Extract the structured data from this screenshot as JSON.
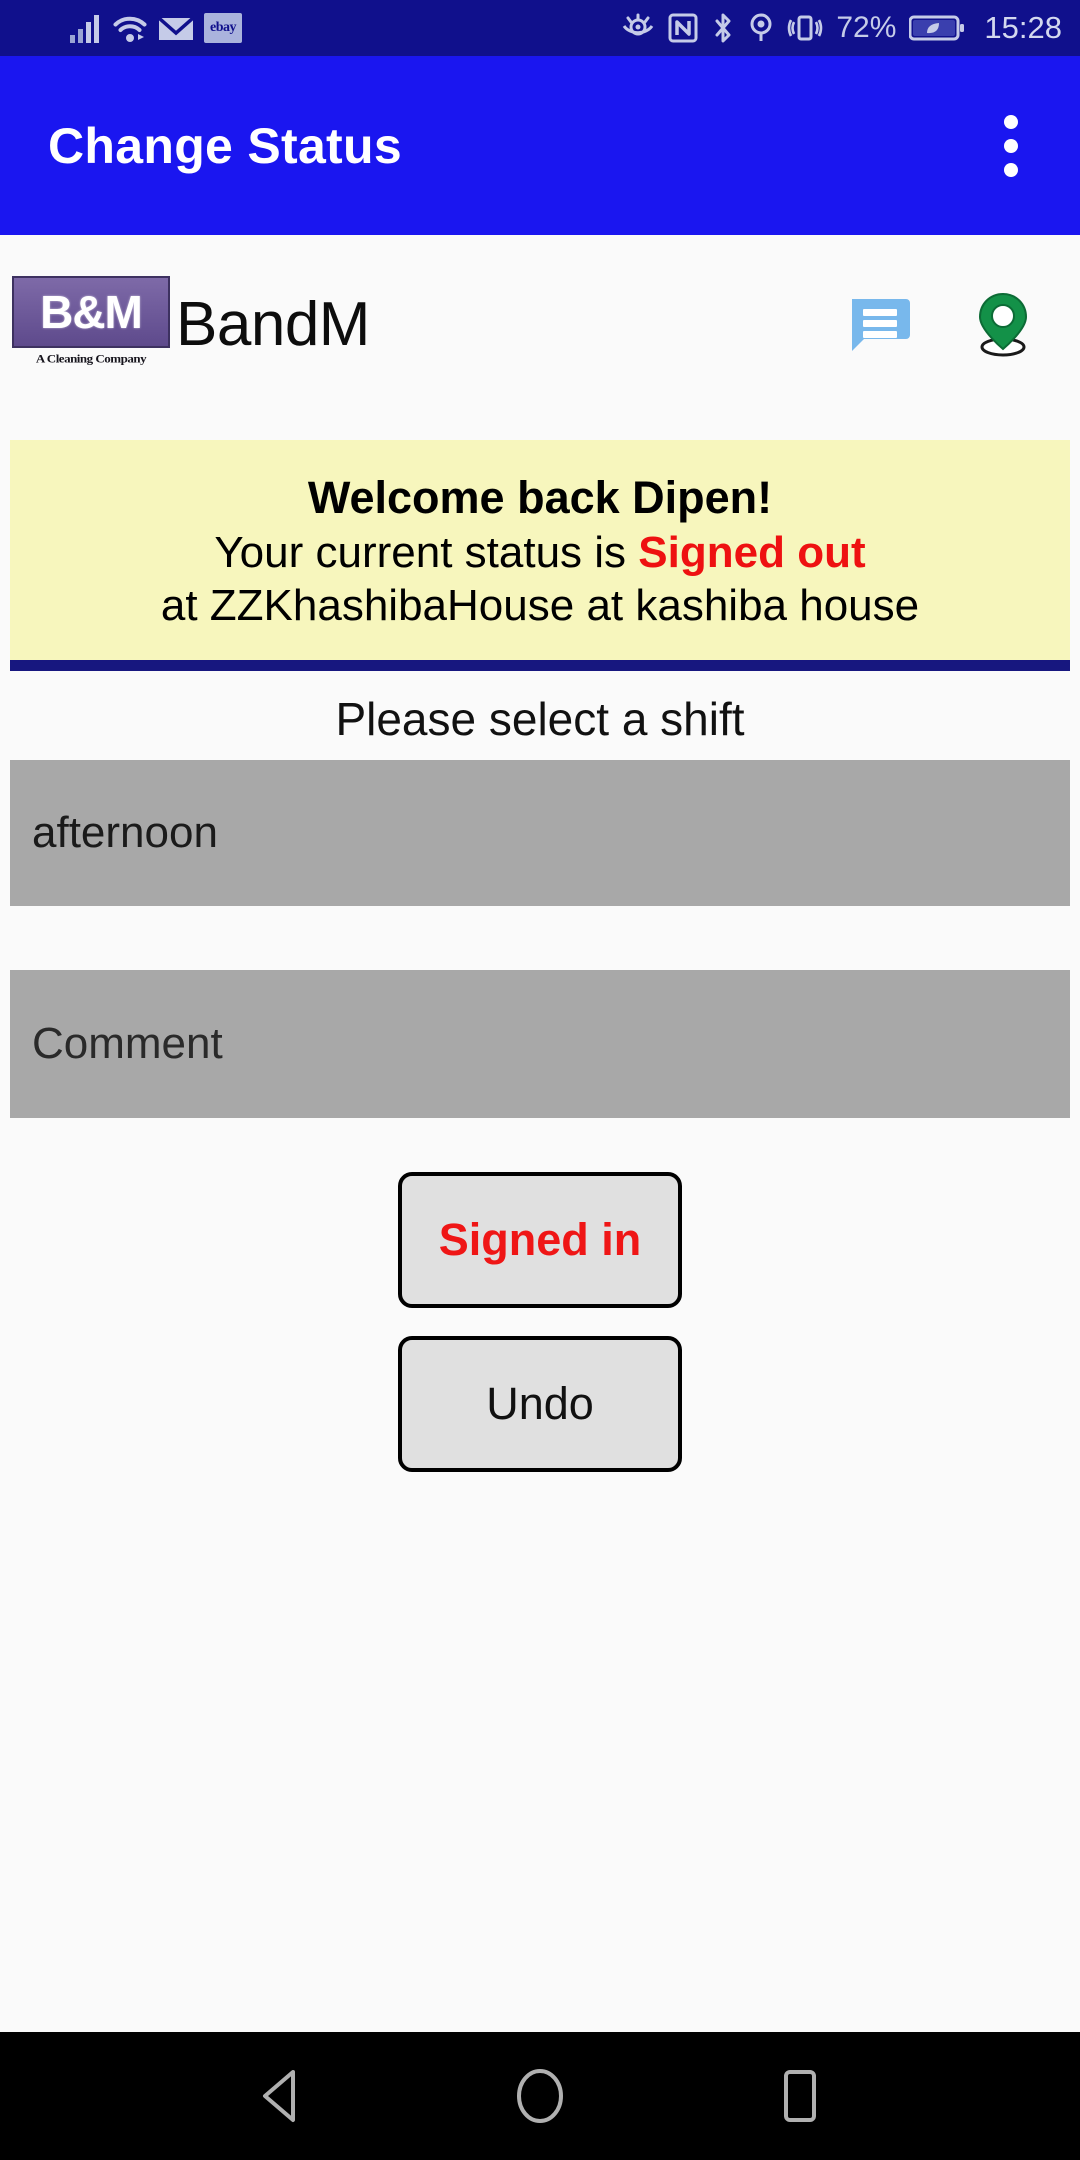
{
  "statusbar": {
    "icons_left": [
      "signal-icon",
      "wifi-icon",
      "email-icon",
      "ebay-icon"
    ],
    "ebay_label": "ebay",
    "icons_right": [
      "eye-comfort-icon",
      "nfc-icon",
      "bluetooth-icon",
      "location-icon",
      "vibrate-icon"
    ],
    "battery_percent": "72%",
    "battery_icon": "battery-saver-icon",
    "time": "15:28"
  },
  "appbar": {
    "title": "Change Status",
    "overflow_icon": "overflow-menu-icon",
    "background": "#1a16f0"
  },
  "brand": {
    "logo_text": "B&M",
    "logo_subtext": "A Cleaning Company",
    "name": "BandM",
    "message_icon": "message-icon",
    "location_icon": "location-pin-icon"
  },
  "banner": {
    "line1": "Welcome back Dipen!",
    "line2_prefix": "Your current status is ",
    "status": "Signed out",
    "status_color": "#ee1111",
    "line3": "at ZZKhashibaHouse at kashiba house",
    "background": "#f7f6bd",
    "divider_color": "#17177f"
  },
  "form": {
    "shift_label": "Please select a shift",
    "shift_value": "afternoon",
    "shift_options": [
      "afternoon"
    ],
    "comment_placeholder": "Comment",
    "comment_value": "",
    "field_background": "#a8a8a8"
  },
  "buttons": {
    "signed_in": "Signed in",
    "signed_in_color": "#ef1616",
    "undo": "Undo"
  },
  "navbar": {
    "back_icon": "back-triangle-icon",
    "home_icon": "home-circle-icon",
    "recents_icon": "recents-square-icon"
  }
}
